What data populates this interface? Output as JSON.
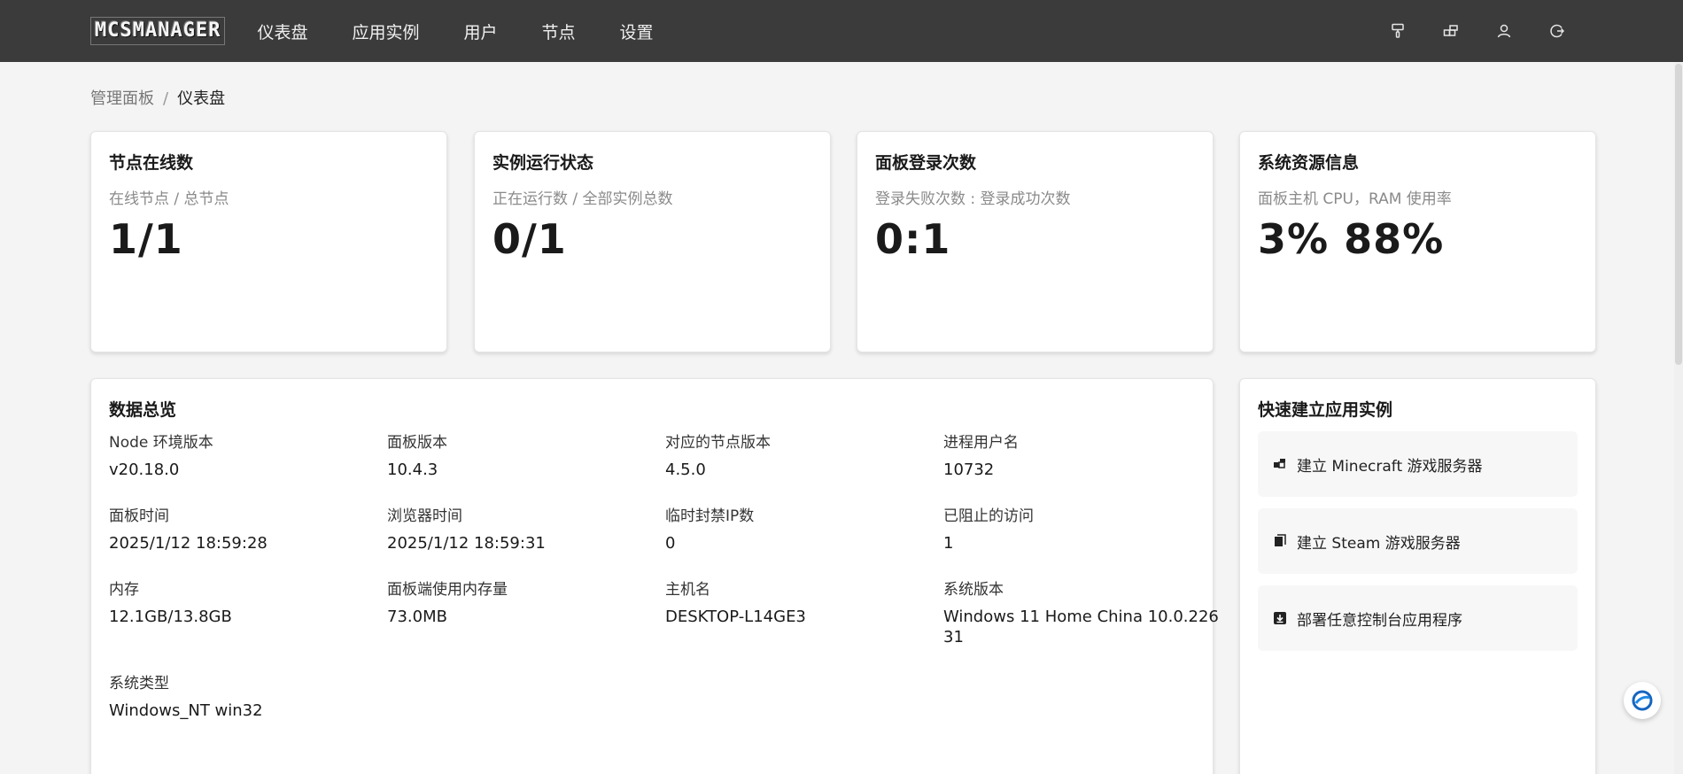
{
  "nav": {
    "logo": "MCSMANAGER",
    "items": [
      {
        "label": "仪表盘"
      },
      {
        "label": "应用实例"
      },
      {
        "label": "用户"
      },
      {
        "label": "节点"
      },
      {
        "label": "设置"
      }
    ],
    "icons": [
      "brush-icon",
      "layout-icon",
      "user-icon",
      "logout-icon"
    ]
  },
  "breadcrumb": {
    "root": "管理面板",
    "separator": "/",
    "current": "仪表盘"
  },
  "stats": [
    {
      "title": "节点在线数",
      "subtitle": "在线节点 / 总节点",
      "value": "1/1"
    },
    {
      "title": "实例运行状态",
      "subtitle": "正在运行数 / 全部实例总数",
      "value": "0/1"
    },
    {
      "title": "面板登录次数",
      "subtitle": "登录失败次数 : 登录成功次数",
      "value": "0:1"
    },
    {
      "title": "系统资源信息",
      "subtitle": "面板主机 CPU，RAM 使用率",
      "value": "3% 88%"
    }
  ],
  "overview": {
    "title": "数据总览",
    "rows": [
      [
        {
          "label": "Node 环境版本",
          "value": "v20.18.0"
        },
        {
          "label": "面板版本",
          "value": "10.4.3"
        },
        {
          "label": "对应的节点版本",
          "value": "4.5.0"
        },
        {
          "label": "进程用户名",
          "value": "10732"
        }
      ],
      [
        {
          "label": "面板时间",
          "value": "2025/1/12 18:59:28"
        },
        {
          "label": "浏览器时间",
          "value": "2025/1/12 18:59:31"
        },
        {
          "label": "临时封禁IP数",
          "value": "0"
        },
        {
          "label": "已阻止的访问",
          "value": "1"
        }
      ],
      [
        {
          "label": "内存",
          "value": "12.1GB/13.8GB"
        },
        {
          "label": "面板端使用内存量",
          "value": "73.0MB"
        },
        {
          "label": "主机名",
          "value": "DESKTOP-L14GE3"
        },
        {
          "label": "系统版本",
          "value": "Windows 11 Home China 10.0.22631"
        }
      ],
      [
        {
          "label": "系统类型",
          "value": "Windows_NT win32"
        }
      ]
    ]
  },
  "quick": {
    "title": "快速建立应用实例",
    "items": [
      {
        "label": "建立 Minecraft 游戏服务器",
        "icon": "blocks-icon"
      },
      {
        "label": "建立 Steam 游戏服务器",
        "icon": "copy-icon"
      },
      {
        "label": "部署任意控制台应用程序",
        "icon": "download-box-icon"
      }
    ]
  }
}
